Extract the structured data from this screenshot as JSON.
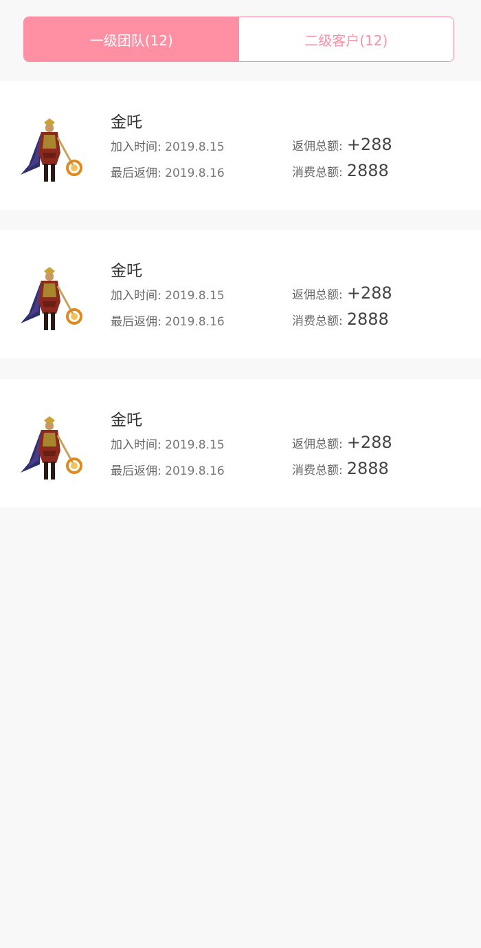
{
  "tabs": [
    {
      "label": "一级团队(12)",
      "active": true
    },
    {
      "label": "二级客户(12)",
      "active": false
    }
  ],
  "labels": {
    "join_time": "加入时间: ",
    "last_commission": "最后返佣: ",
    "commission_total": "返佣总额:",
    "spend_total": "消费总额:"
  },
  "members": [
    {
      "name": "金吒",
      "join_date": "2019.8.15",
      "last_commission_date": "2019.8.16",
      "commission_total": "+288",
      "spend_total": "2888"
    },
    {
      "name": "金吒",
      "join_date": "2019.8.15",
      "last_commission_date": "2019.8.16",
      "commission_total": "+288",
      "spend_total": "2888"
    },
    {
      "name": "金吒",
      "join_date": "2019.8.15",
      "last_commission_date": "2019.8.16",
      "commission_total": "+288",
      "spend_total": "2888"
    }
  ],
  "colors": {
    "accent": "#ff8fa3",
    "background": "#f8f8f8",
    "card": "#ffffff"
  },
  "icons": {
    "avatar": "hero-character-avatar"
  }
}
